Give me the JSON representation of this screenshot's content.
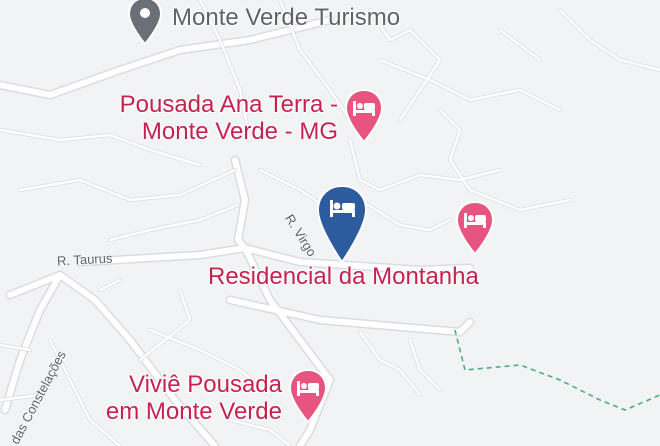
{
  "map": {
    "places": [
      {
        "name": "Monte Verde Turismo",
        "icon": "place-pin-icon",
        "color": "#6b7076"
      },
      {
        "name_lines": [
          "Pousada Ana Terra -",
          "Monte Verde - MG"
        ],
        "icon": "hotel-bed-icon",
        "color": "#e75480"
      },
      {
        "name": "Residencial da Montanha",
        "icon": "hotel-bed-icon",
        "color": "#2c5b9e",
        "selected": true
      },
      {
        "name": "",
        "icon": "hotel-bed-icon",
        "color": "#e75480"
      },
      {
        "name_lines": [
          "Viviê Pousada",
          "em Monte Verde"
        ],
        "icon": "hotel-bed-icon",
        "color": "#e75480"
      }
    ],
    "streets": [
      "R. Virgo",
      "R. Taurus",
      "das Constelações"
    ],
    "colors": {
      "background": "#f1f3f4",
      "road": "#ffffff",
      "hotel_label": "#c5224f",
      "hotel_pin": "#e75480",
      "selected_pin": "#2c5b9e",
      "trail": "#4caf7a"
    }
  }
}
